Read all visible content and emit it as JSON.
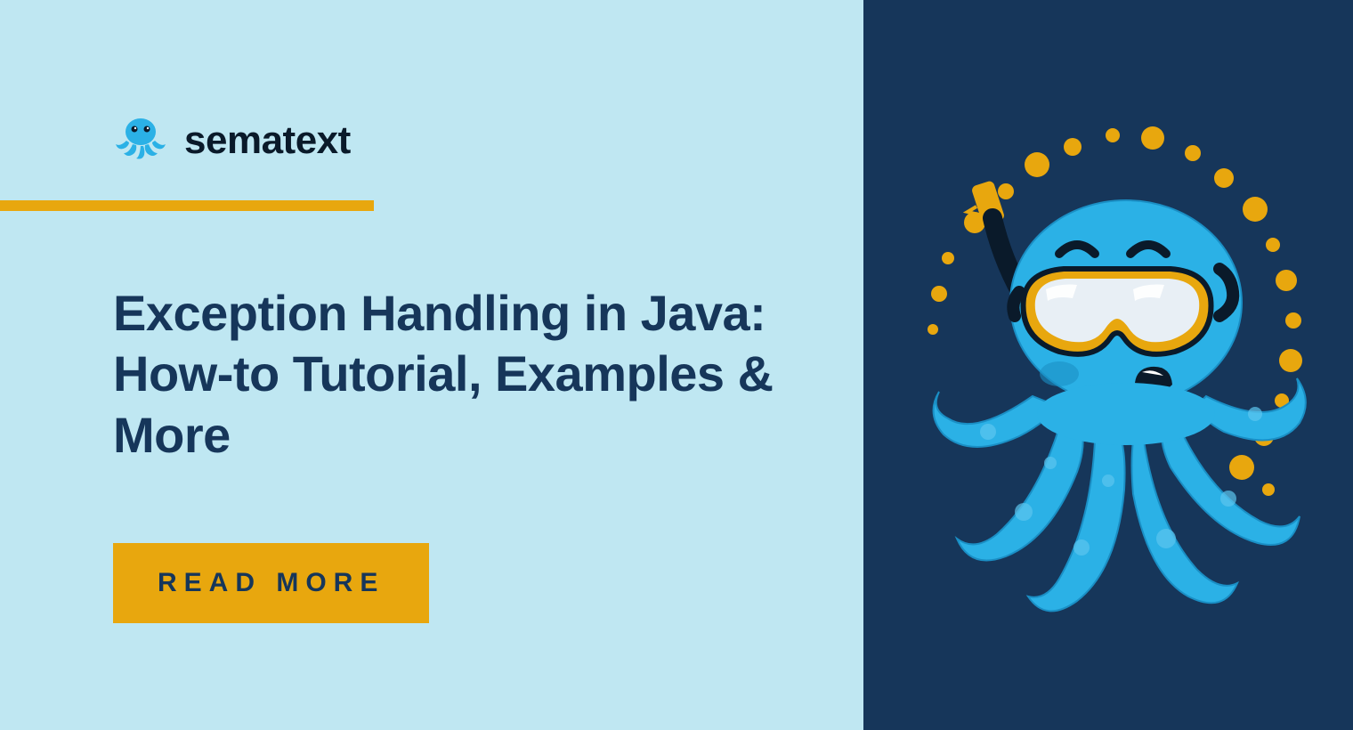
{
  "brand": {
    "name": "sematext"
  },
  "heading": "Exception Handling in Java: How-to Tutorial, Examples & More",
  "cta": {
    "label": "READ MORE"
  },
  "colors": {
    "leftBg": "#bfe7f2",
    "rightBg": "#16365a",
    "accent": "#e8a70e",
    "headingColor": "#16365a",
    "mascotBlue": "#2bb1e6",
    "mascotBlueDark": "#1a8fc5"
  }
}
